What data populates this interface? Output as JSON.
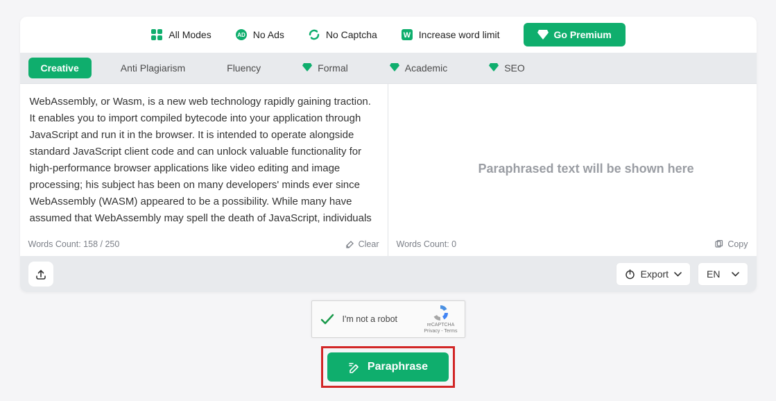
{
  "topbar": {
    "allModes": "All Modes",
    "noAds": "No Ads",
    "noCaptcha": "No Captcha",
    "increaseLimit": "Increase word limit",
    "premium": "Go Premium"
  },
  "modes": {
    "creative": "Creative",
    "antiPlag": "Anti Plagiarism",
    "fluency": "Fluency",
    "formal": "Formal",
    "academic": "Academic",
    "seo": "SEO"
  },
  "input": {
    "text": "WebAssembly, or Wasm, is a new web technology rapidly gaining traction. It enables you to import compiled bytecode into your application through JavaScript and run it in the browser. It is intended to operate alongside standard JavaScript client code and can unlock valuable functionality for high-performance browser applications like video editing and image processing; his subject has been on many developers' minds ever since WebAssembly (WASM) appeared to be a possibility. While many have assumed that WebAssembly may spell the death of JavaScript, individuals",
    "wordsCount": "Words Count: 158 / 250",
    "clear": "Clear"
  },
  "output": {
    "placeholder": "Paraphrased text will be shown here",
    "wordsCount": "Words Count: 0",
    "copy": "Copy"
  },
  "footer": {
    "export": "Export",
    "lang": "EN"
  },
  "captcha": {
    "label": "I'm not a robot",
    "brand": "reCAPTCHA",
    "legal": "Privacy - Terms"
  },
  "cta": {
    "label": "Paraphrase"
  }
}
